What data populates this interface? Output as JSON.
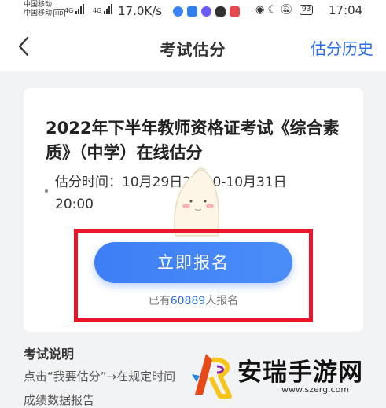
{
  "status_bar": {
    "carrier_1": "中国移动",
    "carrier_2": "中国移动",
    "hd_badge": "HD",
    "sig1": "4G",
    "sig2": "4G",
    "net_speed": "17.0K/s",
    "battery": "93",
    "time": "17:04"
  },
  "nav": {
    "title": "考试估分",
    "history_link": "估分历史"
  },
  "card": {
    "exam_title": "2022年下半年教师资格证考试《综合素质》（中学）在线估分",
    "estimate_time": "估分时间：10月29日20:00-10月31日20:00",
    "signup_button": "立即报名",
    "count_prefix": "已有",
    "count_number": "60889",
    "count_suffix": "人报名"
  },
  "explain": {
    "heading": "考试说明",
    "line1": "点击“我要估分”→在规定时间",
    "line2": "成绩数据报告"
  },
  "watermark": {
    "site_name": "安瑞手游网",
    "url": "www.szerg.com"
  },
  "colors": {
    "accent": "#2b6ce8",
    "button": "#3d7ef6",
    "highlight": "#e8152b"
  }
}
